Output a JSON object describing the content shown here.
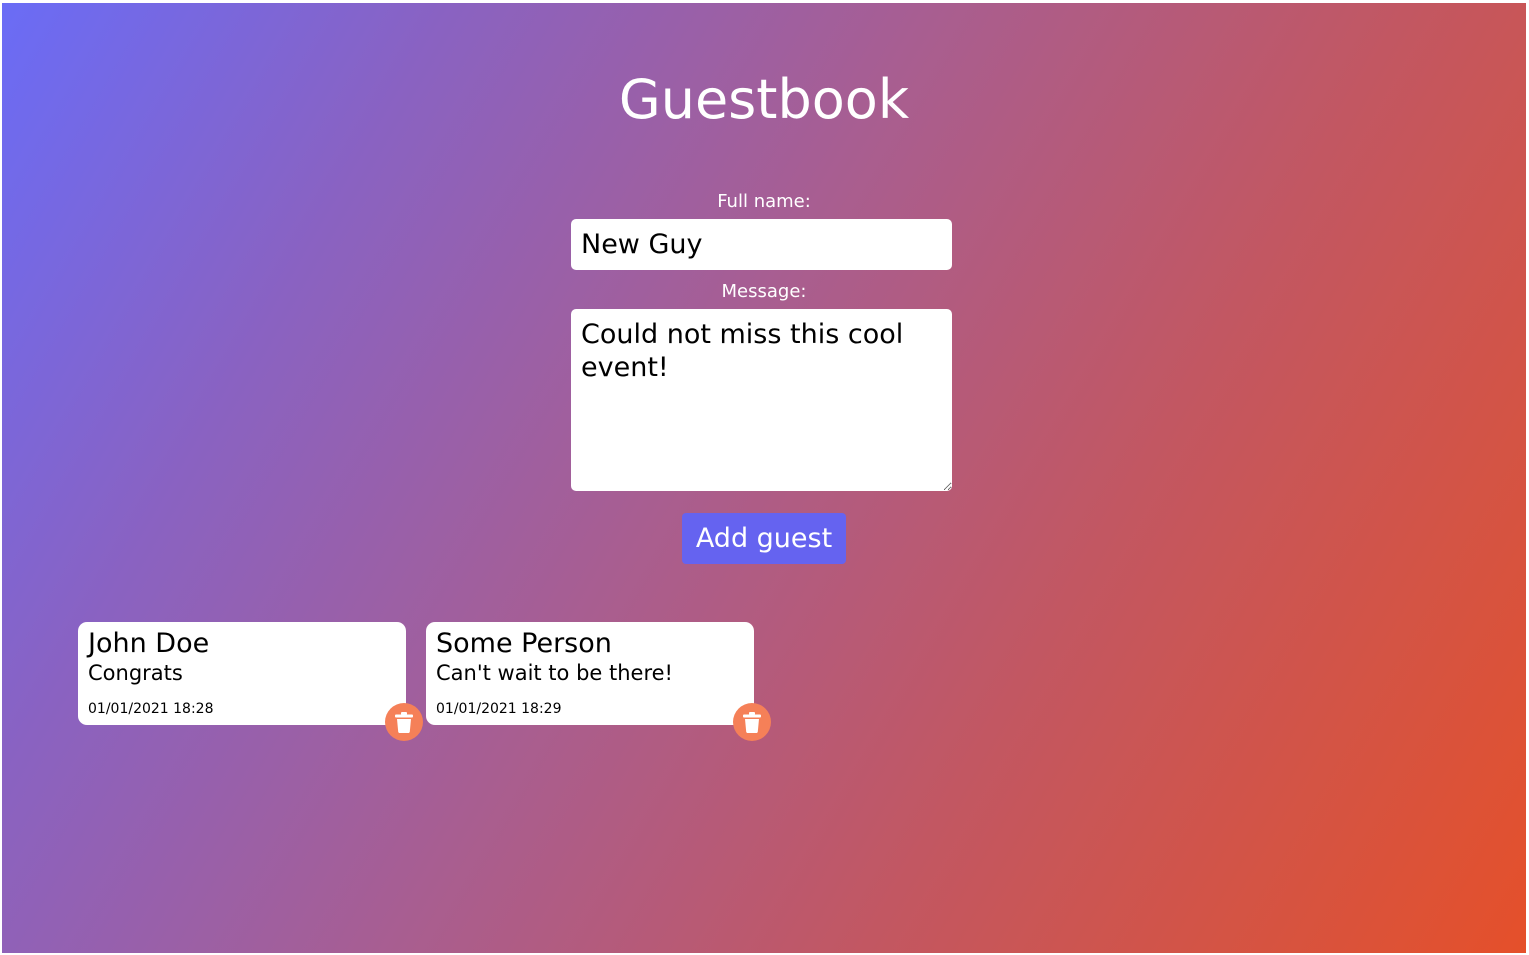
{
  "header": {
    "title": "Guestbook"
  },
  "form": {
    "name_label": "Full name:",
    "name_value": "New Guy",
    "message_label": "Message:",
    "message_value": "Could not miss this cool event!",
    "submit_label": "Add guest"
  },
  "guests": [
    {
      "name": "John Doe",
      "message": "Congrats",
      "date": "01/01/2021 18:28",
      "delete_icon": "trash-icon"
    },
    {
      "name": "Some Person",
      "message": "Can't wait to be there!",
      "date": "01/01/2021 18:29",
      "delete_icon": "trash-icon"
    }
  ],
  "colors": {
    "gradient_start": "#6a6cf6",
    "gradient_end": "#e5502a",
    "button": "#6563f0",
    "delete_button": "#f58058"
  }
}
